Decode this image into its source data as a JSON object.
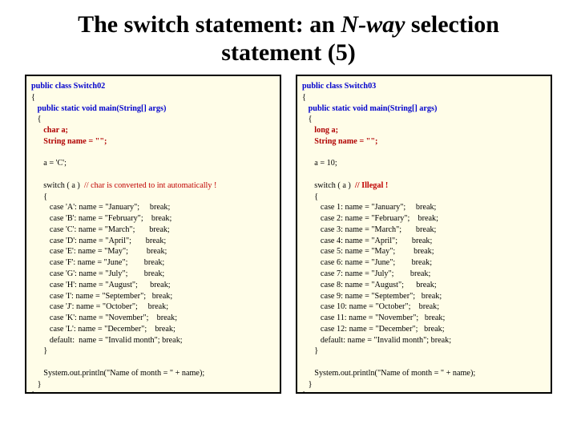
{
  "title_plain_a": "The switch statement: an ",
  "title_ital": "N-way",
  "title_plain_b": " selection statement (5)",
  "code_left": {
    "l01": "public class Switch02",
    "l02": "{",
    "l03": "   public static void main(String[] args)",
    "l04": "   {",
    "l05": "      char a;",
    "l06": "      String name = \"\";",
    "l07": "",
    "l08": "      a = 'C';",
    "l09": "",
    "l10a": "      switch ( a )  ",
    "l10b": "// char is converted to int automatically !",
    "l11": "      {",
    "l12": "         case 'A': name = \"January\";     break;",
    "l13": "         case 'B': name = \"February\";    break;",
    "l14": "         case 'C': name = \"March\";       break;",
    "l15": "         case 'D': name = \"April\";       break;",
    "l16": "         case 'E': name = \"May\";         break;",
    "l17": "         case 'F': name = \"June\";        break;",
    "l18": "         case 'G': name = \"July\";        break;",
    "l19": "         case 'H': name = \"August\";      break;",
    "l20": "         case 'I': name = \"September\";   break;",
    "l21": "         case 'J': name = \"October\";     break;",
    "l22": "         case 'K': name = \"November\";    break;",
    "l23": "         case 'L': name = \"December\";    break;",
    "l24": "         default:  name = \"Invalid month\"; break;",
    "l25": "      }",
    "l26": "",
    "l27": "      System.out.println(\"Name of month = \" + name);",
    "l28": "   }",
    "l29": "}"
  },
  "code_right": {
    "l01": "public class Switch03",
    "l02": "{",
    "l03": "   public static void main(String[] args)",
    "l04": "   {",
    "l05": "      long a;",
    "l06": "      String name = \"\";",
    "l07": "",
    "l08": "      a = 10;",
    "l09": "",
    "l10a": "      switch ( a )  ",
    "l10b": "// Illegal !",
    "l11": "      {",
    "l12": "         case 1: name = \"January\";     break;",
    "l13": "         case 2: name = \"February\";    break;",
    "l14": "         case 3: name = \"March\";       break;",
    "l15": "         case 4: name = \"April\";       break;",
    "l16": "         case 5: name = \"May\";         break;",
    "l17": "         case 6: name = \"June\";        break;",
    "l18": "         case 7: name = \"July\";        break;",
    "l19": "         case 8: name = \"August\";      break;",
    "l20": "         case 9: name = \"September\";   break;",
    "l21": "         case 10: name = \"October\";    break;",
    "l22": "         case 11: name = \"November\";   break;",
    "l23": "         case 12: name = \"December\";   break;",
    "l24": "         default: name = \"Invalid month\"; break;",
    "l25": "      }",
    "l26": "",
    "l27": "      System.out.println(\"Name of month = \" + name);",
    "l28": "   }",
    "l29": "}"
  }
}
